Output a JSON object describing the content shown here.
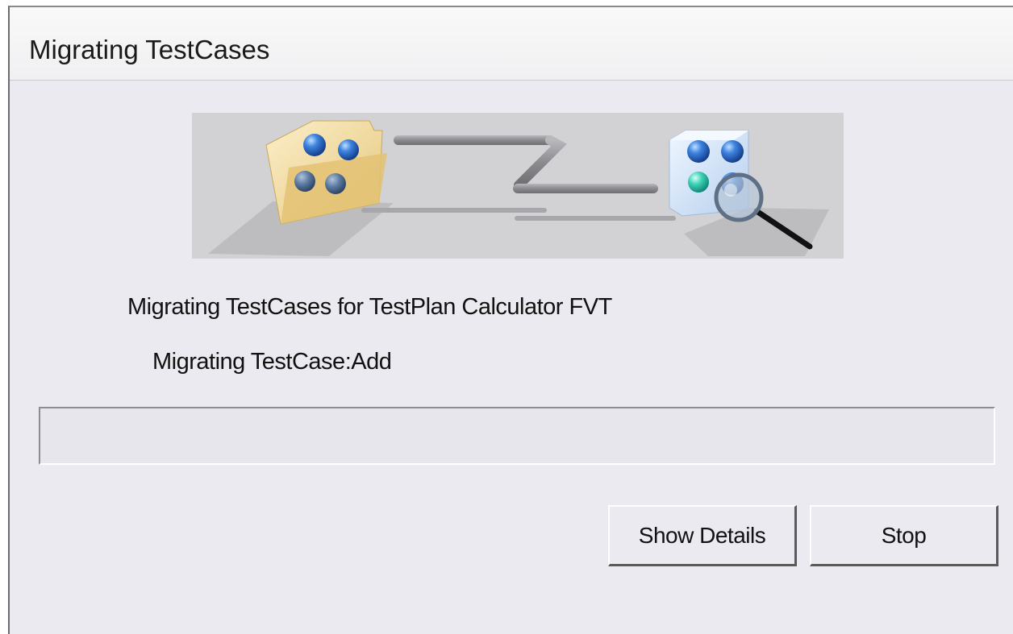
{
  "window": {
    "title": "Migrating TestCases"
  },
  "status": {
    "plan_text": "Migrating TestCases for TestPlan Calculator FVT",
    "case_text": "Migrating TestCase:Add"
  },
  "progress": {
    "value_percent": 0
  },
  "buttons": {
    "show_details": "Show Details",
    "stop": "Stop"
  },
  "banner": {
    "icons": [
      "folder-icon",
      "database-cube-icon",
      "magnifier-icon"
    ],
    "colors": {
      "background": "#d2d2d4",
      "folder": "#f3dfa4",
      "sphere": "#2c69c8",
      "cube": "#cfe0f4",
      "pipe": "#8c8c90"
    }
  }
}
